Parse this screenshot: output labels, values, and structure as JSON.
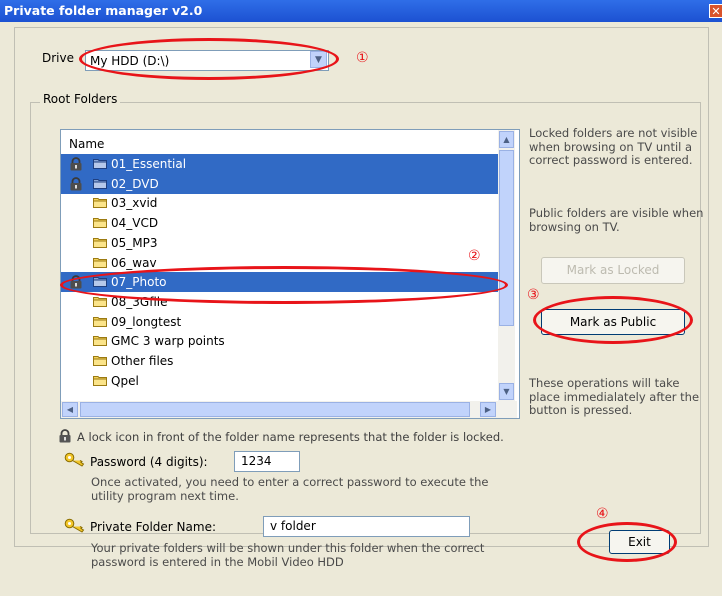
{
  "window": {
    "title": "Private folder manager v2.0",
    "close_icon": "close-icon"
  },
  "drive": {
    "label": "Drive",
    "value": "My HDD (D:\\)"
  },
  "root_folders": {
    "label": "Root Folders",
    "column_header": "Name",
    "folders": [
      {
        "name": "01_Essential",
        "locked": true,
        "selected": true
      },
      {
        "name": "02_DVD",
        "locked": true,
        "selected": true
      },
      {
        "name": "03_xvid",
        "locked": false,
        "selected": false
      },
      {
        "name": "04_VCD",
        "locked": false,
        "selected": false
      },
      {
        "name": "05_MP3",
        "locked": false,
        "selected": false
      },
      {
        "name": "06_wav",
        "locked": false,
        "selected": false
      },
      {
        "name": "07_Photo",
        "locked": true,
        "selected": true
      },
      {
        "name": "08_3Gfile",
        "locked": false,
        "selected": false
      },
      {
        "name": "09_longtest",
        "locked": false,
        "selected": false
      },
      {
        "name": "GMC 3 warp points",
        "locked": false,
        "selected": false
      },
      {
        "name": "Other files",
        "locked": false,
        "selected": false
      },
      {
        "name": "Qpel",
        "locked": false,
        "selected": false
      }
    ]
  },
  "side": {
    "locked_info": "Locked folders are not visible when browsing on TV until a correct password is entered.",
    "public_info": "Public folders are visible when browsing on TV.",
    "mark_locked_label": "Mark as Locked",
    "mark_public_label": "Mark as Public",
    "ops_info": "These operations will take place immedialately after the button is pressed."
  },
  "lock_legend": "A lock icon in front of the folder name represents that the folder is locked.",
  "password": {
    "label": "Password (4 digits):",
    "value": "1234",
    "note": "Once activated, you need to enter a correct password to execute the utility program next time."
  },
  "private_folder": {
    "label": "Private Folder Name:",
    "value": "v folder",
    "note": "Your private folders will be shown under this folder when the correct password is entered in the Mobil Video HDD"
  },
  "exit_label": "Exit",
  "annotations": {
    "m1": "①",
    "m2": "②",
    "m3": "③",
    "m4": "④"
  },
  "colors": {
    "title_bar": "#1c51d2",
    "selection": "#316ac5",
    "callout": "#e81419",
    "client_bg": "#ece9d8"
  }
}
